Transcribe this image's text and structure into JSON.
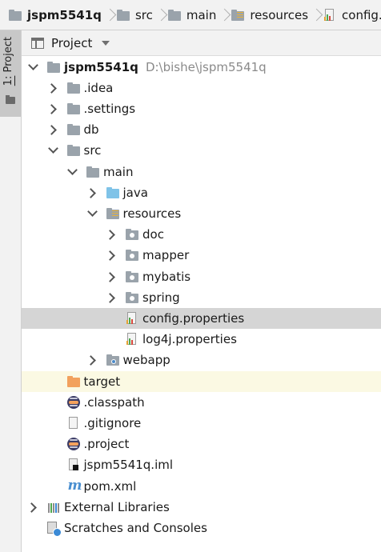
{
  "breadcrumb": [
    {
      "label": "jspm5541q",
      "icon": "module-folder-icon",
      "bold": true
    },
    {
      "label": "src",
      "icon": "folder-icon"
    },
    {
      "label": "main",
      "icon": "folder-icon"
    },
    {
      "label": "resources",
      "icon": "resources-folder-icon"
    },
    {
      "label": "config.prop",
      "icon": "properties-file-icon"
    }
  ],
  "sidebar": {
    "tab_prefix": "1:",
    "tab_label": " Project"
  },
  "toolbar": {
    "title": "Project"
  },
  "tree": {
    "rows": [
      {
        "label": "jspm5541q",
        "path": "D:\\bishe\\jspm5541q",
        "bold": true,
        "arrow": "down",
        "icon": "module-folder-icon"
      },
      {
        "label": ".idea",
        "arrow": "right",
        "icon": "folder-icon"
      },
      {
        "label": ".settings",
        "arrow": "right",
        "icon": "folder-icon"
      },
      {
        "label": "db",
        "arrow": "right",
        "icon": "folder-icon"
      },
      {
        "label": "src",
        "arrow": "down",
        "icon": "folder-icon"
      },
      {
        "label": "main",
        "arrow": "down",
        "icon": "folder-icon"
      },
      {
        "label": "java",
        "arrow": "right",
        "icon": "source-folder-icon"
      },
      {
        "label": "resources",
        "arrow": "down",
        "icon": "resources-folder-icon"
      },
      {
        "label": "doc",
        "arrow": "right",
        "icon": "package-folder-icon"
      },
      {
        "label": "mapper",
        "arrow": "right",
        "icon": "package-folder-icon"
      },
      {
        "label": "mybatis",
        "arrow": "right",
        "icon": "package-folder-icon"
      },
      {
        "label": "spring",
        "arrow": "right",
        "icon": "package-folder-icon"
      },
      {
        "label": "config.properties",
        "arrow": "none",
        "icon": "properties-file-icon",
        "selected": true
      },
      {
        "label": "log4j.properties",
        "arrow": "none",
        "icon": "properties-file-icon"
      },
      {
        "label": "webapp",
        "arrow": "right",
        "icon": "web-folder-icon"
      },
      {
        "label": "target",
        "arrow": "none",
        "icon": "excluded-folder-icon",
        "highlighted": true
      },
      {
        "label": ".classpath",
        "arrow": "none",
        "icon": "eclipse-icon"
      },
      {
        "label": ".gitignore",
        "arrow": "none",
        "icon": "text-file-icon"
      },
      {
        "label": ".project",
        "arrow": "none",
        "icon": "eclipse-icon"
      },
      {
        "label": "jspm5541q.iml",
        "arrow": "none",
        "icon": "iml-file-icon"
      },
      {
        "label": "pom.xml",
        "arrow": "none",
        "icon": "maven-icon"
      },
      {
        "label": "External Libraries",
        "arrow": "right",
        "icon": "library-icon"
      },
      {
        "label": "Scratches and Consoles",
        "arrow": "none",
        "icon": "scratches-icon"
      }
    ]
  },
  "colors": {
    "selection": "#d5d5d5",
    "highlight": "#fbf9e3",
    "path_gray": "#8a8a8a",
    "folder_gray": "#9aa3ab",
    "source_blue": "#7fc3e8",
    "excluded_orange": "#f2a15d"
  }
}
